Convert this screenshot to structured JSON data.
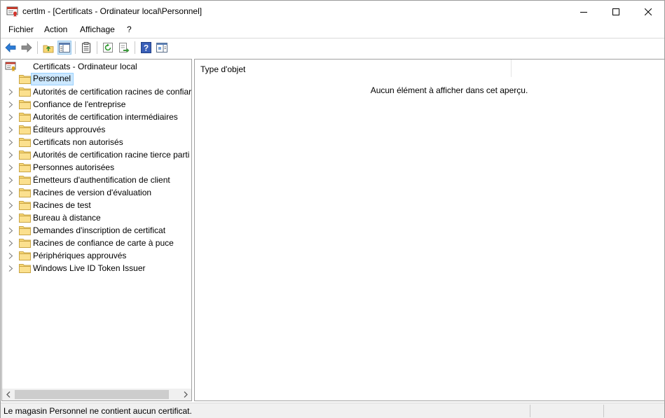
{
  "window": {
    "title": "certlm - [Certificats - Ordinateur local\\Personnel]"
  },
  "menu": {
    "items": [
      "Fichier",
      "Action",
      "Affichage",
      "?"
    ]
  },
  "toolbar": {
    "icons": [
      "back-arrow-icon",
      "forward-arrow-icon",
      "up-folder-icon",
      "show-hide-tree-icon",
      "properties-icon",
      "refresh-icon",
      "export-list-icon",
      "help-icon",
      "show-hide-action-pane-icon"
    ]
  },
  "tree": {
    "root": "Certificats - Ordinateur local",
    "items": [
      "Personnel",
      "Autorités de certification racines de confiar",
      "Confiance de l'entreprise",
      "Autorités de certification intermédiaires",
      "Éditeurs approuvés",
      "Certificats non autorisés",
      "Autorités de certification racine tierce parti",
      "Personnes autorisées",
      "Émetteurs d'authentification de client",
      "Racines de version d'évaluation",
      "Racines de test",
      "Bureau à distance",
      "Demandes d'inscription de certificat",
      "Racines de confiance de carte à puce",
      "Périphériques approuvés",
      "Windows Live ID Token Issuer"
    ],
    "selected_index": 0
  },
  "list": {
    "column_type": "Type d'objet",
    "empty_message": "Aucun élément à afficher dans cet aperçu."
  },
  "status": {
    "text": "Le magasin Personnel ne contient aucun certificat."
  },
  "colors": {
    "selection_bg": "#cce8ff",
    "folder_yellow": "#f8d775",
    "back_blue": "#2b7bd6"
  }
}
